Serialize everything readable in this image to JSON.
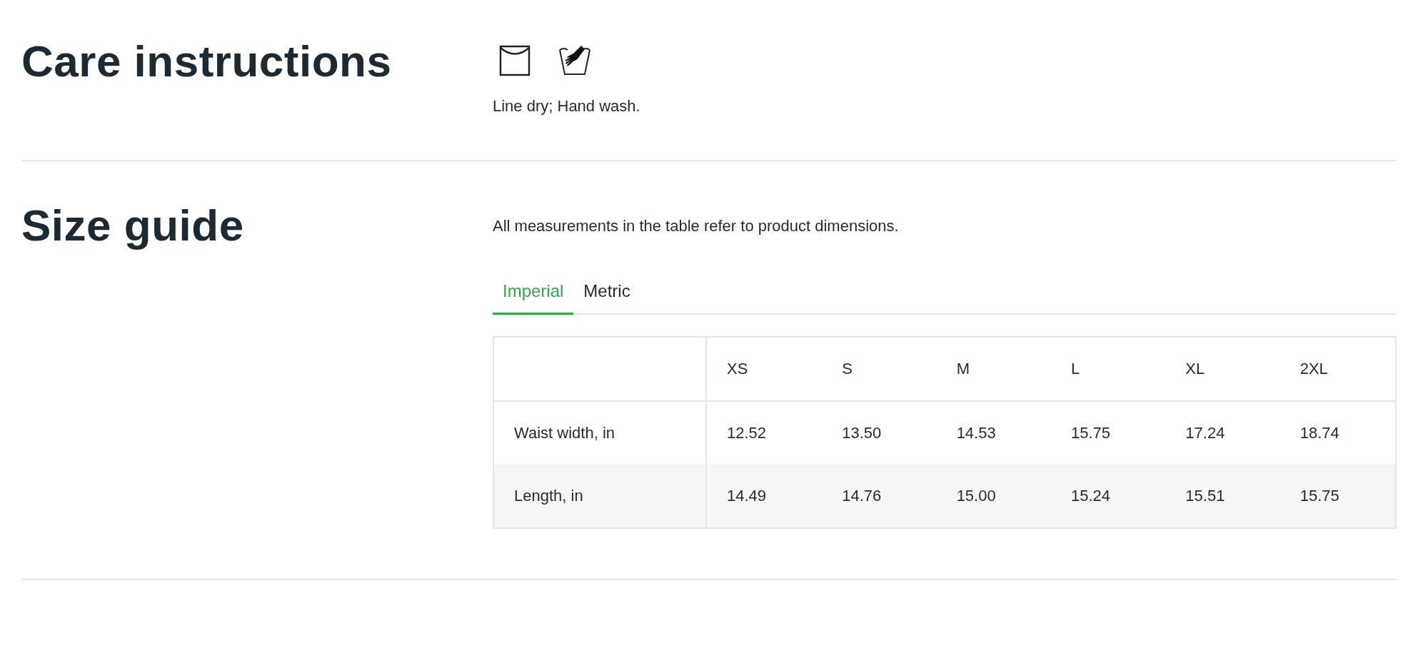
{
  "care": {
    "heading": "Care instructions",
    "symbols": [
      {
        "kind": "line-dry"
      },
      {
        "kind": "hand-wash"
      }
    ],
    "text": "Line dry; Hand wash."
  },
  "size_guide": {
    "heading": "Size guide",
    "description": "All measurements in the table refer to product dimensions.",
    "tabs": [
      {
        "label": "Imperial",
        "selected": true
      },
      {
        "label": "Metric",
        "selected": false
      }
    ],
    "table": {
      "columns": [
        "XS",
        "S",
        "M",
        "L",
        "XL",
        "2XL"
      ],
      "rows": [
        {
          "label": "Waist width, in",
          "values": [
            "12.52",
            "13.50",
            "14.53",
            "15.75",
            "17.24",
            "18.74"
          ]
        },
        {
          "label": "Length, in",
          "values": [
            "14.49",
            "14.76",
            "15.00",
            "15.24",
            "15.51",
            "15.75"
          ]
        }
      ]
    }
  }
}
